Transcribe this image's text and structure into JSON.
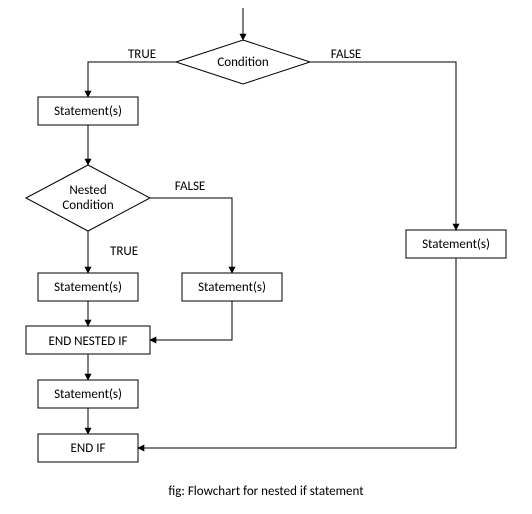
{
  "labels": {
    "true": "TRUE",
    "false": "FALSE"
  },
  "nodes": {
    "condition": "Condition",
    "nested_condition_l1": "Nested",
    "nested_condition_l2": "Condition",
    "stmt_true_outer": "Statement(s)",
    "stmt_false_outer": "Statement(s)",
    "stmt_nested_true": "Statement(s)",
    "stmt_nested_false": "Statement(s)",
    "end_nested": "END NESTED IF",
    "stmt_after_nested": "Statement(s)",
    "end_if": "END IF"
  },
  "caption": "fig: Flowchart for nested if statement"
}
